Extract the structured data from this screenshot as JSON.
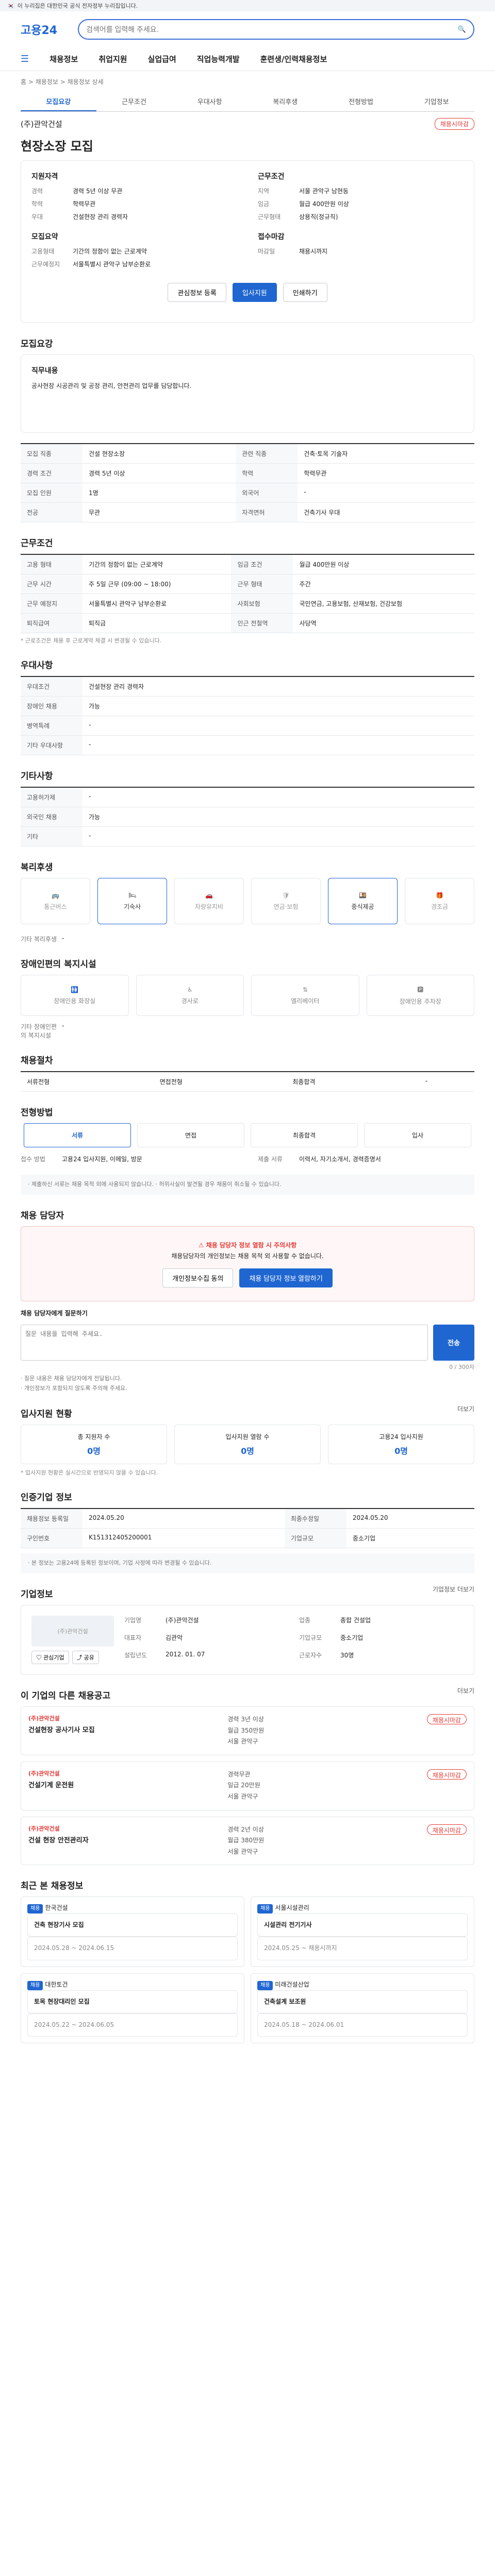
{
  "topbar": {
    "text": "이 누리집은 대한민국 공식 전자정부 누리집입니다."
  },
  "header": {
    "logo": "고용24",
    "search_placeholder": "검색어를 입력해 주세요."
  },
  "gnb": [
    "채용정보",
    "취업지원",
    "실업급여",
    "직업능력개발",
    "훈련생/인력채용정보"
  ],
  "crumb": "홈 > 채용정보 > 채용정보 상세",
  "tabs": [
    "모집요강",
    "근무조건",
    "우대사항",
    "복리후생",
    "전형방법",
    "기업정보"
  ],
  "company": {
    "name": "(주)관악건설",
    "badge": "채용시마감"
  },
  "title": "현장소장 모집",
  "summary": {
    "left_title": "지원자격",
    "left": [
      [
        "경력",
        "경력 5년 이상 무관"
      ],
      [
        "학력",
        "학력무관"
      ],
      [
        "우대",
        "건설현장 관리 경력자"
      ]
    ],
    "right_title": "근무조건",
    "right": [
      [
        "지역",
        "서울 관악구 남현동"
      ],
      [
        "임금",
        "월급 400만원 이상"
      ],
      [
        "근무형태",
        "상용직(정규직)"
      ]
    ],
    "recruit_title": "모집요약",
    "recruit": [
      [
        "고용형태",
        "기간의 정함이 없는 근로계약"
      ],
      [
        "근무예정지",
        "서울특별시 관악구 남부순환로"
      ]
    ],
    "close_title": "접수마감",
    "close": [
      [
        "마감일",
        "채용시까지"
      ]
    ]
  },
  "buttons": {
    "scrap": "관심정보 등록",
    "apply": "입사지원",
    "print": "인쇄하기"
  },
  "recruit_section": {
    "title": "모집요강",
    "duty_title": "직무내용",
    "duty": "공사현장 시공관리 및 공정 관리, 안전관리 업무를 담당합니다.",
    "rows": [
      [
        "모집 직종",
        "건설 현장소장",
        "관련 직종",
        "건축·토목 기술자"
      ],
      [
        "경력 조건",
        "경력 5년 이상",
        "학력",
        "학력무관"
      ],
      [
        "모집 인원",
        "1명",
        "외국어",
        "-"
      ],
      [
        "전공",
        "무관",
        "자격면허",
        "건축기사 우대"
      ]
    ]
  },
  "condition_section": {
    "title": "근무조건",
    "rows": [
      [
        "고용 형태",
        "기간의 정함이 없는 근로계약",
        "임금 조건",
        "월급 400만원 이상"
      ],
      [
        "근무 시간",
        "주 5일 근무 (09:00 ~ 18:00)",
        "근무 형태",
        "주간"
      ],
      [
        "근무 예정지",
        "서울특별시 관악구 남부순환로",
        "사회보험",
        "국민연금, 고용보험, 산재보험, 건강보험"
      ],
      [
        "퇴직급여",
        "퇴직금",
        "인근 전철역",
        "사당역"
      ]
    ],
    "note": "* 근로조건은 채용 후 근로계약 체결 시 변경될 수 있습니다."
  },
  "preference_section": {
    "title": "우대사항",
    "rows": [
      [
        "우대조건",
        "건설현장 관리 경력자"
      ],
      [
        "장애인 채용",
        "가능"
      ],
      [
        "병역특례",
        "-"
      ],
      [
        "기타 우대사항",
        "-"
      ]
    ]
  },
  "other_section": {
    "title": "기타사항",
    "rows": [
      [
        "고용허가제",
        "-"
      ],
      [
        "외국인 채용",
        "가능"
      ],
      [
        "기타",
        "-"
      ]
    ]
  },
  "welfare_section": {
    "title": "복리후생",
    "items": [
      {
        "label": "통근버스",
        "on": false
      },
      {
        "label": "기숙사",
        "on": true
      },
      {
        "label": "차량유지비",
        "on": false
      },
      {
        "label": "연금·보험",
        "on": false
      },
      {
        "label": "중식제공",
        "on": true
      },
      {
        "label": "경조금",
        "on": false
      }
    ],
    "extra_label": "기타 복리후생",
    "extra_value": "-"
  },
  "disability_section": {
    "title": "장애인편의 복지시설",
    "items": [
      "장애인용 화장실",
      "경사로",
      "엘리베이터",
      "장애인용 주차장"
    ],
    "extra_label": "기타 장애인편의 복지시설",
    "extra_value": "-"
  },
  "worker_section": {
    "title": "채용절차",
    "rows": [
      [
        "서류전형",
        "면접전형",
        "최종합격",
        "-"
      ]
    ]
  },
  "process_section": {
    "title": "전형방법",
    "steps": [
      "서류",
      "면접",
      "최종합격",
      "입사"
    ],
    "method": [
      "접수 방법",
      "고용24 입사지원, 이메일, 방문"
    ],
    "docs": [
      "제출 서류",
      "이력서, 자기소개서, 경력증명서"
    ],
    "notice": "· 제출하신 서류는 채용 목적 외에 사용되지 않습니다. · 허위사실이 발견될 경우 채용이 취소될 수 있습니다."
  },
  "contact_section": {
    "title": "채용 담당자",
    "message": "채용 담당자 정보 열람 시 주의사항",
    "sub": "채용담당자의 개인정보는 채용 목적 외 사용할 수 없습니다.",
    "btn1": "개인정보수집 동의",
    "btn2": "채용 담당자 정보 열람하기",
    "qa_label": "채용 담당자에게 질문하기",
    "qa_placeholder": "질문 내용을 입력해 주세요.",
    "qa_send": "전송",
    "qa_count": "0 / 300자",
    "notes": [
      "· 질문 내용은 채용 담당자에게 전달됩니다.",
      "· 개인정보가 포함되지 않도록 주의해 주세요."
    ]
  },
  "applicant_section": {
    "title": "입사지원 현황",
    "more": "더보기",
    "stats": [
      [
        "총 지원자 수",
        "0명"
      ],
      [
        "입사지원 열람 수",
        "0명"
      ],
      [
        "고용24 입사지원",
        "0명"
      ]
    ],
    "note": "* 입사지원 현황은 실시간으로 반영되지 않을 수 있습니다."
  },
  "info_section": {
    "title": "인증기업 정보",
    "rows": [
      [
        "채용정보 등록일",
        "2024.05.20",
        "최종수정일",
        "2024.05.20"
      ],
      [
        "구인번호",
        "K151312405200001",
        "기업규모",
        "중소기업"
      ]
    ],
    "notice": "· 본 정보는 고용24에 등록된 정보이며, 기업 사정에 따라 변경될 수 있습니다."
  },
  "company_section": {
    "title": "기업정보",
    "more": "기업정보 더보기",
    "logo_text": "(주)관악건설",
    "btn_fav": "관심기업",
    "btn_share": "공유",
    "rows": [
      [
        "기업명",
        "(주)관악건설"
      ],
      [
        "업종",
        "종합 건설업"
      ],
      [
        "대표자",
        "김관악"
      ],
      [
        "기업규모",
        "중소기업"
      ],
      [
        "설립년도",
        "2012. 01. 07"
      ],
      [
        "근로자수",
        "30명"
      ]
    ]
  },
  "other_jobs_section": {
    "title": "이 기업의 다른 채용공고",
    "more": "더보기",
    "jobs": [
      {
        "co": "(주)관악건설",
        "title": "건설현장 공사기사 모집",
        "info": [
          "경력 3년 이상",
          "월급 350만원",
          "서울 관악구"
        ],
        "badge": "채용시마감"
      },
      {
        "co": "(주)관악건설",
        "title": "건설기계 운전원",
        "info": [
          "경력무관",
          "일급 20만원",
          "서울 관악구"
        ],
        "badge": "채용시마감"
      },
      {
        "co": "(주)관악건설",
        "title": "건설 현장 안전관리자",
        "info": [
          "경력 2년 이상",
          "월급 380만원",
          "서울 관악구"
        ],
        "badge": "채용시마감"
      }
    ]
  },
  "recent_section": {
    "title": "최근 본 채용정보",
    "items": [
      {
        "tag": "채용",
        "co": "한국건설",
        "title": "건축 현장기사 모집",
        "date": "2024.05.28 ~ 2024.06.15"
      },
      {
        "tag": "채용",
        "co": "서울시설관리",
        "title": "시설관리 전기기사",
        "date": "2024.05.25 ~ 채용시까지"
      },
      {
        "tag": "채용",
        "co": "대한토건",
        "title": "토목 현장대리인 모집",
        "date": "2024.05.22 ~ 2024.06.05"
      },
      {
        "tag": "채용",
        "co": "미래건설산업",
        "title": "건축설계 보조원",
        "date": "2024.05.18 ~ 2024.06.01"
      }
    ]
  }
}
